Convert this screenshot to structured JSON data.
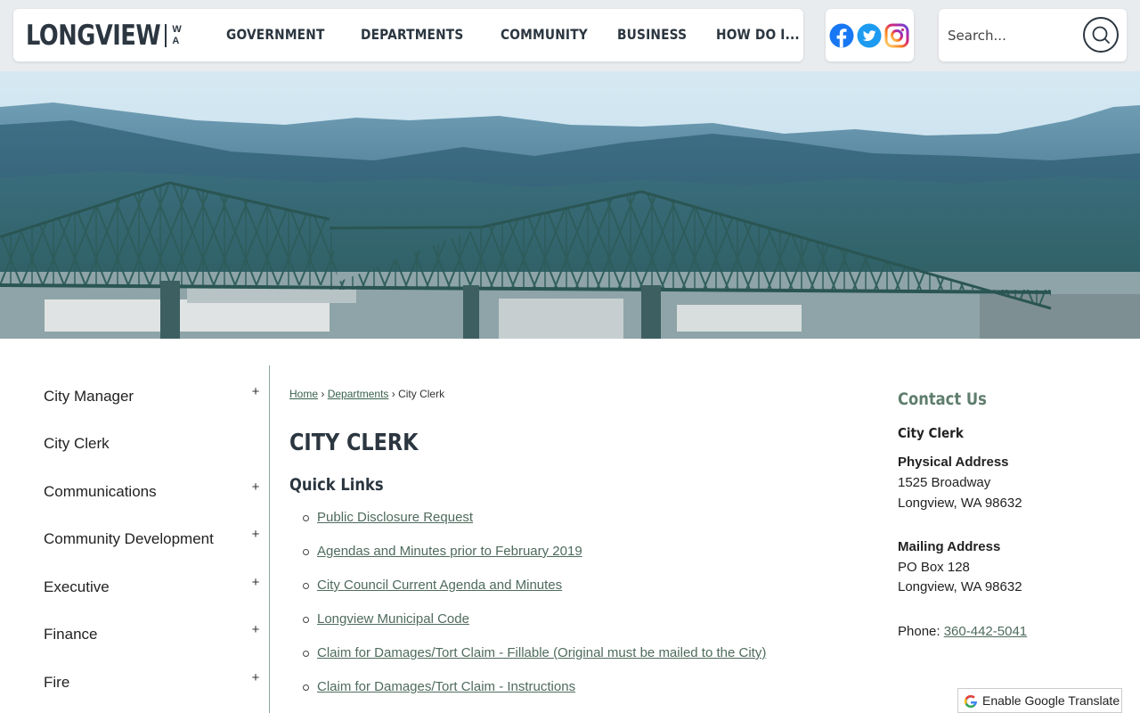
{
  "header": {
    "logo": {
      "word": "LONGVIEW",
      "state_top": "W",
      "state_bottom": "A"
    },
    "nav": [
      "GOVERNMENT",
      "DEPARTMENTS",
      "COMMUNITY",
      "BUSINESS",
      "HOW DO I..."
    ],
    "social": [
      "facebook-icon",
      "twitter-icon",
      "instagram-icon"
    ],
    "search": {
      "placeholder": "Search...",
      "icon": "search-icon"
    }
  },
  "sidebar": {
    "items": [
      {
        "label": "City Manager",
        "expand": "+"
      },
      {
        "label": "City Clerk",
        "expand": ""
      },
      {
        "label": "Communications",
        "expand": "+"
      },
      {
        "label": "Community Development",
        "expand": "+"
      },
      {
        "label": "Executive",
        "expand": "+"
      },
      {
        "label": "Finance",
        "expand": "+"
      },
      {
        "label": "Fire",
        "expand": "+"
      }
    ]
  },
  "main": {
    "breadcrumb": {
      "home": "Home",
      "sep": "›",
      "departments": "Departments",
      "current": "City Clerk"
    },
    "title": "CITY CLERK",
    "quick_links_heading": "Quick Links",
    "quick_links": [
      "Public Disclosure Request",
      "Agendas and Minutes prior to February 2019",
      "City Council Current Agenda and Minutes",
      "Longview Municipal Code",
      "Claim for Damages/Tort Claim - Fillable (Original must be mailed to the City)",
      "Claim for Damages/Tort Claim - Instructions"
    ]
  },
  "contact": {
    "heading": "Contact Us",
    "department": "City Clerk",
    "physical_label": "Physical Address",
    "physical_line1": "1525 Broadway",
    "physical_line2": "Longview, WA 98632",
    "mailing_label": "Mailing Address",
    "mailing_line1": "PO Box 128",
    "mailing_line2": "Longview, WA 98632",
    "phone_label": "Phone:",
    "phone": "360-442-5041"
  },
  "translate": {
    "label": "Enable Google Translate"
  },
  "colors": {
    "header_bg": "#e9ecef",
    "nav_text": "#2b3640",
    "link": "#4f6b5d",
    "contact_heading": "#5f7d6d",
    "facebook": "#1877f2",
    "twitter": "#1d9bf0"
  }
}
